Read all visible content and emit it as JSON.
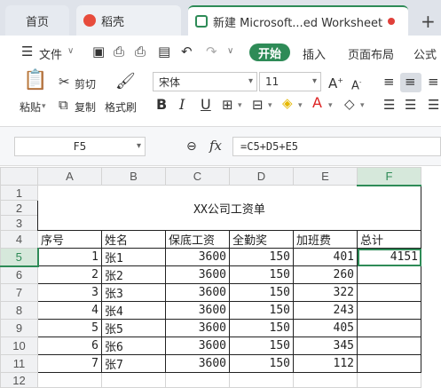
{
  "tabs": {
    "home": "首页",
    "docer": "稻壳",
    "doc": "新建 Microsoft...ed Worksheet",
    "new": "+"
  },
  "menu": {
    "file": "文件",
    "start": "开始",
    "insert": "插入",
    "layout": "页面布局",
    "formula": "公式"
  },
  "ribbon": {
    "paste": "粘贴",
    "cut": "剪切",
    "copy": "复制",
    "format_painter": "格式刷",
    "font_name": "宋体",
    "font_size": "11",
    "bold": "B",
    "italic": "I",
    "underline": "U"
  },
  "formula_bar": {
    "name_box": "F5",
    "fx": "fx",
    "formula": "=C5+D5+E5"
  },
  "columns": [
    "A",
    "B",
    "C",
    "D",
    "E",
    "F"
  ],
  "rows": [
    "1",
    "2",
    "3",
    "4",
    "5",
    "6",
    "7",
    "8",
    "9",
    "10",
    "11",
    "12"
  ],
  "sheet": {
    "title": "XX公司工资单",
    "headers": [
      "序号",
      "姓名",
      "保底工资",
      "全勤奖",
      "加班费",
      "总计"
    ],
    "data": [
      [
        "1",
        "张1",
        "3600",
        "150",
        "401",
        "4151"
      ],
      [
        "2",
        "张2",
        "3600",
        "150",
        "260",
        ""
      ],
      [
        "3",
        "张3",
        "3600",
        "150",
        "322",
        ""
      ],
      [
        "4",
        "张4",
        "3600",
        "150",
        "243",
        ""
      ],
      [
        "5",
        "张5",
        "3600",
        "150",
        "405",
        ""
      ],
      [
        "6",
        "张6",
        "3600",
        "150",
        "345",
        ""
      ],
      [
        "7",
        "张7",
        "3600",
        "150",
        "112",
        ""
      ]
    ]
  },
  "colors": {
    "accent": "#2e8b57",
    "tabbar": "#dfe3ea"
  }
}
